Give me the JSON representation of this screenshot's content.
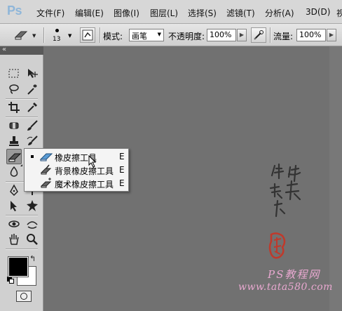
{
  "app": {
    "logo": "Ps"
  },
  "menubar": {
    "items": [
      "文件(F)",
      "编辑(E)",
      "图像(I)",
      "图层(L)",
      "选择(S)",
      "滤镜(T)",
      "分析(A)",
      "3D(D)",
      "视"
    ]
  },
  "options": {
    "brush_size": "13",
    "mode_label": "模式:",
    "mode_value": "画笔",
    "opacity_label": "不透明度:",
    "opacity_value": "100%",
    "flow_label": "流量:",
    "flow_value": "100%"
  },
  "flyout": {
    "items": [
      {
        "label": "橡皮擦工具",
        "key": "E",
        "selected": true
      },
      {
        "label": "背景橡皮擦工具",
        "key": "E",
        "selected": false
      },
      {
        "label": "魔术橡皮擦工具",
        "key": "E",
        "selected": false
      }
    ]
  },
  "colors": {
    "foreground": "#000000",
    "background": "#ffffff",
    "canvas": "#717171",
    "stamp_red": "#c0392b"
  },
  "watermark": {
    "site_name": "PS教程网",
    "site_url": "www.tata580.com"
  },
  "icons": {
    "tools": [
      "marquee-icon",
      "move-icon",
      "lasso-icon",
      "magic-wand-icon",
      "crop-icon",
      "eyedropper-icon",
      "healing-brush-icon",
      "brush-icon",
      "clone-stamp-icon",
      "history-brush-icon",
      "eraser-icon",
      "gradient-icon",
      "blur-icon",
      "dodge-icon",
      "pen-icon",
      "type-icon",
      "path-selection-icon",
      "shape-icon",
      "3d-rotate-icon",
      "3d-orbit-icon",
      "hand-icon",
      "zoom-icon",
      "quick-mask-icon"
    ]
  }
}
